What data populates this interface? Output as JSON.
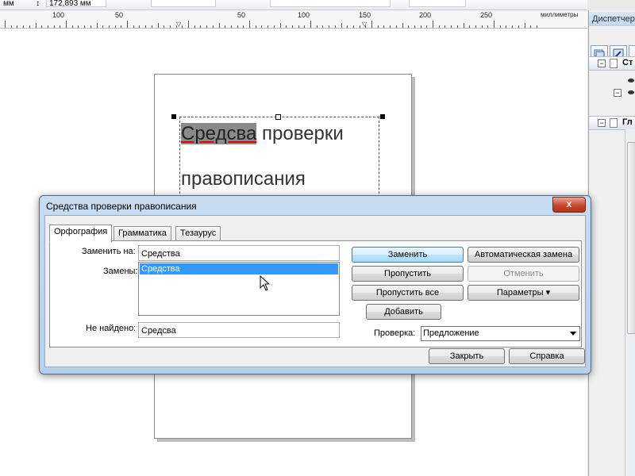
{
  "propbar": {
    "unit_text": "мм",
    "height_value": "172,893 мм"
  },
  "ruler": {
    "labels": [
      "100",
      "50",
      "50",
      "100",
      "150",
      "200",
      "250"
    ],
    "units": "миллиметры"
  },
  "document": {
    "word_highlighted": "Средсва",
    "rest_line1": "проверки",
    "line2": "правописания"
  },
  "docker": {
    "title": "Диспетчер",
    "group1_label": "Ст",
    "group2_label": "Гл"
  },
  "dialog": {
    "title": "Средства проверки правописания",
    "close_glyph": "x",
    "tabs": [
      "Орфография",
      "Грамматика",
      "Тезаурус"
    ],
    "replace_with_label": "Заменить на:",
    "replace_with_value": "Средства",
    "replacements_label": "Замены:",
    "replacements": [
      "Средства"
    ],
    "not_found_label": "Не найдено:",
    "not_found_value": "Средсва",
    "buttons": {
      "replace": "Заменить",
      "auto_replace": "Автоматическая замена",
      "skip": "Пропустить",
      "undo": "Отменить",
      "skip_all": "Пропустить все",
      "options": "Параметры",
      "add": "Добавить",
      "close": "Закрыть",
      "help": "Справка"
    },
    "check_label": "Проверка:",
    "check_value": "Предложение"
  }
}
